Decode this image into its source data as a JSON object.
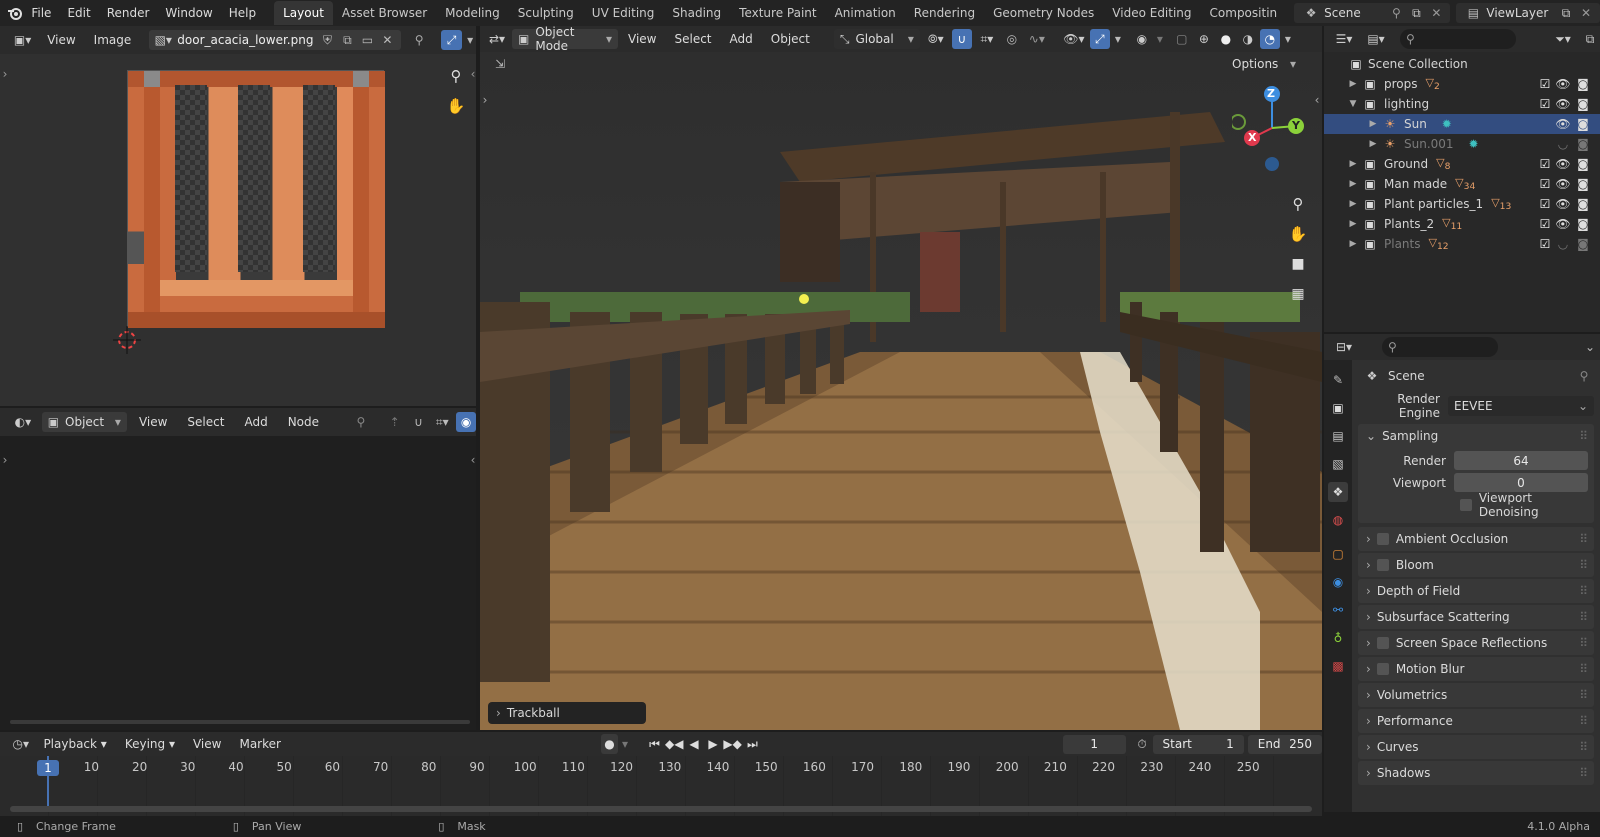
{
  "topbar": {
    "menus": [
      "File",
      "Edit",
      "Render",
      "Window",
      "Help"
    ],
    "workspaces": [
      "Layout",
      "Asset Browser",
      "Modeling",
      "Sculpting",
      "UV Editing",
      "Shading",
      "Texture Paint",
      "Animation",
      "Rendering",
      "Geometry Nodes",
      "Video Editing",
      "Compositin"
    ],
    "active_workspace": "Layout",
    "scene_name": "Scene",
    "view_layer": "ViewLayer"
  },
  "image_editor": {
    "menus": [
      "View",
      "Image"
    ],
    "image_name": "door_acacia_lower.png"
  },
  "node_editor": {
    "type_label": "Object",
    "menus": [
      "View",
      "Select",
      "Add",
      "Node"
    ]
  },
  "viewport": {
    "mode": "Object Mode",
    "menus": [
      "View",
      "Select",
      "Add",
      "Object"
    ],
    "orientation": "Global",
    "options_label": "Options",
    "operator_panel": "Trackball",
    "gizmo": {
      "x": "X",
      "y": "Y",
      "z": "Z"
    }
  },
  "outliner": {
    "root": "Scene Collection",
    "items": [
      {
        "name": "props",
        "badge": "2",
        "indent": 1,
        "expanded": false,
        "selected": false,
        "dim": false
      },
      {
        "name": "lighting",
        "badge": "",
        "indent": 1,
        "expanded": true,
        "selected": false,
        "dim": false
      },
      {
        "name": "Sun",
        "badge": "",
        "indent": 2,
        "expanded": false,
        "selected": true,
        "dim": false
      },
      {
        "name": "Sun.001",
        "badge": "",
        "indent": 2,
        "expanded": false,
        "selected": false,
        "dim": true
      },
      {
        "name": "Ground",
        "badge": "8",
        "indent": 1,
        "expanded": false,
        "selected": false,
        "dim": false
      },
      {
        "name": "Man made",
        "badge": "34",
        "indent": 1,
        "expanded": false,
        "selected": false,
        "dim": false
      },
      {
        "name": "Plant particles_1",
        "badge": "13",
        "indent": 1,
        "expanded": false,
        "selected": false,
        "dim": false
      },
      {
        "name": "Plants_2",
        "badge": "11",
        "indent": 1,
        "expanded": false,
        "selected": false,
        "dim": false
      },
      {
        "name": "Plants",
        "badge": "12",
        "indent": 1,
        "expanded": false,
        "selected": false,
        "dim": true
      }
    ]
  },
  "properties": {
    "context": "Scene",
    "render_engine_label": "Render Engine",
    "render_engine": "EEVEE",
    "sampling": {
      "title": "Sampling",
      "render_label": "Render",
      "render_value": "64",
      "viewport_label": "Viewport",
      "viewport_value": "0",
      "denoise_label": "Viewport Denoising"
    },
    "sections": [
      {
        "label": "Ambient Occlusion",
        "checkbox": true
      },
      {
        "label": "Bloom",
        "checkbox": true
      },
      {
        "label": "Depth of Field",
        "checkbox": false
      },
      {
        "label": "Subsurface Scattering",
        "checkbox": false
      },
      {
        "label": "Screen Space Reflections",
        "checkbox": true
      },
      {
        "label": "Motion Blur",
        "checkbox": true
      },
      {
        "label": "Volumetrics",
        "checkbox": false
      },
      {
        "label": "Performance",
        "checkbox": false
      },
      {
        "label": "Curves",
        "checkbox": false
      },
      {
        "label": "Shadows",
        "checkbox": false
      }
    ]
  },
  "timeline": {
    "menus": [
      "Playback",
      "Keying",
      "View",
      "Marker"
    ],
    "current_frame": "1",
    "start_label": "Start",
    "start": "1",
    "end_label": "End",
    "end": "250",
    "ticks": [
      "1",
      "10",
      "20",
      "30",
      "40",
      "50",
      "60",
      "70",
      "80",
      "90",
      "100",
      "110",
      "120",
      "130",
      "140",
      "150",
      "160",
      "170",
      "180",
      "190",
      "200",
      "210",
      "220",
      "230",
      "240",
      "250"
    ]
  },
  "statusbar": {
    "hints": [
      "Change Frame",
      "Pan View",
      "Mask"
    ],
    "version": "4.1.0 Alpha"
  },
  "colors": {
    "accent_blue": "#4772b3",
    "selection": "#334d80",
    "axis_x": "#e0394d",
    "axis_y": "#8bd13a",
    "axis_z": "#3d8ee0"
  }
}
